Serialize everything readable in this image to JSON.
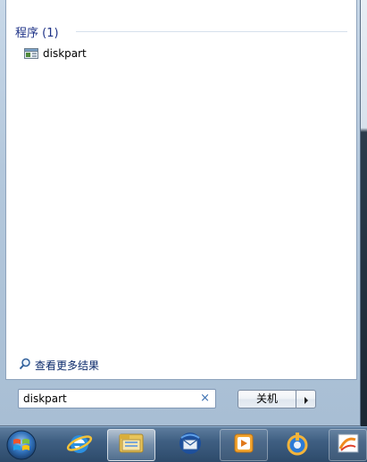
{
  "results": {
    "group_header": "程序 (1)",
    "items": [
      {
        "label": "diskpart",
        "icon": "program-icon"
      }
    ]
  },
  "see_more": {
    "label": "查看更多结果",
    "icon": "search-icon"
  },
  "search": {
    "value": "diskpart",
    "clear_glyph": "×"
  },
  "shutdown": {
    "label": "关机",
    "arrow_icon": "chevron-right-icon"
  },
  "taskbar": {
    "start_icon": "windows-start-orb-icon",
    "items": [
      {
        "icon": "internet-explorer-icon"
      },
      {
        "icon": "file-explorer-icon"
      },
      {
        "icon": "thunderbird-icon"
      },
      {
        "icon": "media-player-icon"
      },
      {
        "icon": "media-center-icon"
      },
      {
        "icon": "paint-icon"
      }
    ]
  },
  "colors": {
    "group_header": "#1e3287",
    "link": "#0b2a6b",
    "clear_x": "#3a6fb0"
  }
}
